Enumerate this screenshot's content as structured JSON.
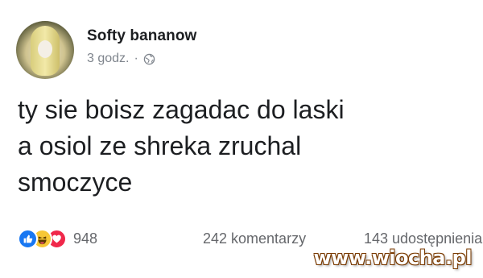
{
  "post": {
    "author": "Softy bananow",
    "time": "3 godz.",
    "separator": "·",
    "content_lines": [
      "ty sie boisz zagadac do laski",
      "a osiol ze shreka zruchal",
      "smoczyce"
    ],
    "reaction_icons": [
      "like-icon",
      "haha-icon",
      "love-icon"
    ],
    "reaction_count": "948",
    "comments_text": "242 komentarzy",
    "shares_text": "143 udostępnienia"
  },
  "watermark": "www.wiocha.pl",
  "colors": {
    "like": "#1877f2",
    "haha": "#f7c736",
    "love": "#f0284a",
    "secondary_text": "#65676b"
  }
}
